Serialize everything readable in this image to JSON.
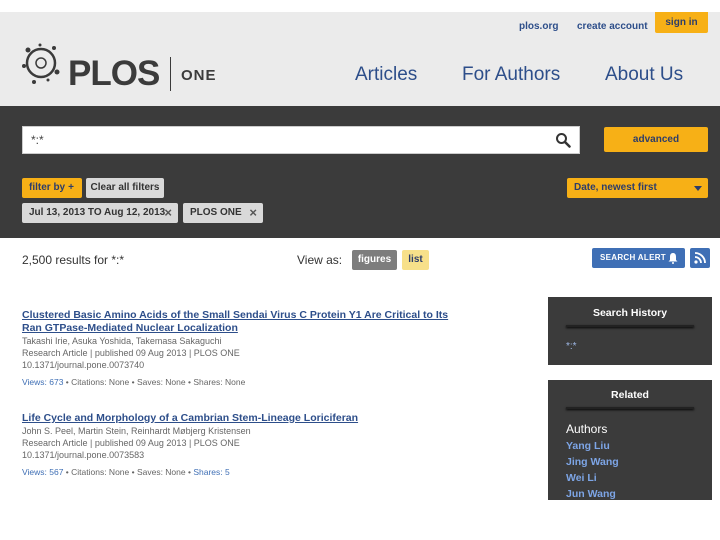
{
  "header": {
    "util_links": [
      "plos.org",
      "create account"
    ],
    "signin_label": "sign in",
    "logo_text": "PLOS",
    "logo_sub": "ONE",
    "nav": [
      "Articles",
      "For Authors",
      "About Us"
    ]
  },
  "search": {
    "query": "*:*",
    "advanced_label": "advanced"
  },
  "filters": {
    "filter_by_label": "filter by",
    "filter_by_icon": "+",
    "clear_label": "Clear all filters",
    "sort_value": "Date, newest first",
    "chips": [
      "Jul 13, 2013 TO Aug 12, 2013",
      "PLOS ONE"
    ],
    "chip_close": "×"
  },
  "results_bar": {
    "count_text": "2,500 results for *:*",
    "view_as_label": "View as:",
    "figures_label": "figures",
    "list_label": "list",
    "search_alert_label": "SEARCH ALERT"
  },
  "results": [
    {
      "title_line1": "Clustered Basic Amino Acids of the Small Sendai Virus C Protein Y1 Are Critical to Its",
      "title_line2": "Ran GTPase-Mediated Nuclear Localization",
      "authors": "Takashi Irie, Asuka Yoshida, Takemasa Sakaguchi",
      "info": "Research Article | published 09 Aug 2013 | PLOS ONE",
      "doi": "10.1371/journal.pone.0073740",
      "views": "Views: 673",
      "rest": " • Citations: None • Saves: None • Shares: None"
    },
    {
      "title_line1": "Life Cycle and Morphology of a Cambrian Stem-Lineage Loriciferan",
      "title_line2": "",
      "authors": "John S. Peel, Martin Stein, Reinhardt Møbjerg Kristensen",
      "info": "Research Article | published 09 Aug 2013 | PLOS ONE",
      "doi": "10.1371/journal.pone.0073583",
      "views": "Views: 567",
      "rest_plain": " • Citations: None • Saves: None • ",
      "shares": "Shares: 5"
    }
  ],
  "sidebar": {
    "history_title": "Search History",
    "history_item": "*:*",
    "related_title": "Related",
    "authors_label": "Authors",
    "authors": [
      "Yang Liu",
      "Jing Wang",
      "Wei Li",
      "Jun Wang"
    ]
  },
  "colors": {
    "accent": "#f7b016",
    "dark_band": "#3b3b3b",
    "link": "#2d4e8a"
  },
  "icons": [
    "plos-logo-icon",
    "search-icon",
    "bell-icon",
    "rss-icon",
    "close-icon",
    "caret-down-icon"
  ]
}
